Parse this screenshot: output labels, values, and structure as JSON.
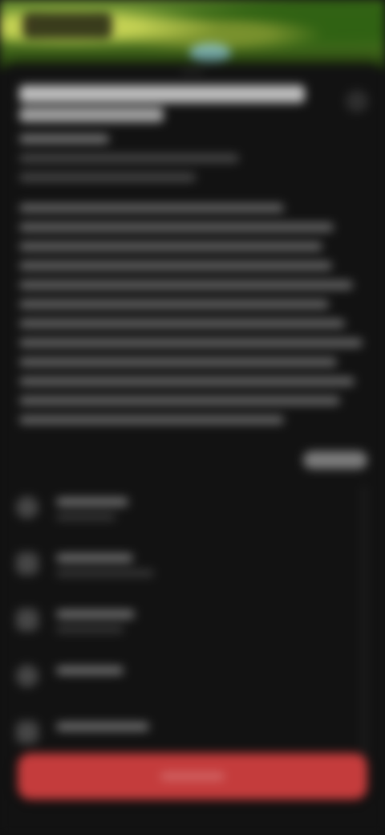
{
  "theme": {
    "background": "#111111",
    "accent": "#c43c3c",
    "hero_green": "#6f9435"
  },
  "icons": {
    "more": "more-icon",
    "item_1": "circle-icon",
    "item_2": "square-icon",
    "item_3": "square-icon",
    "item_4": "circle-icon",
    "item_5": "square-icon"
  }
}
